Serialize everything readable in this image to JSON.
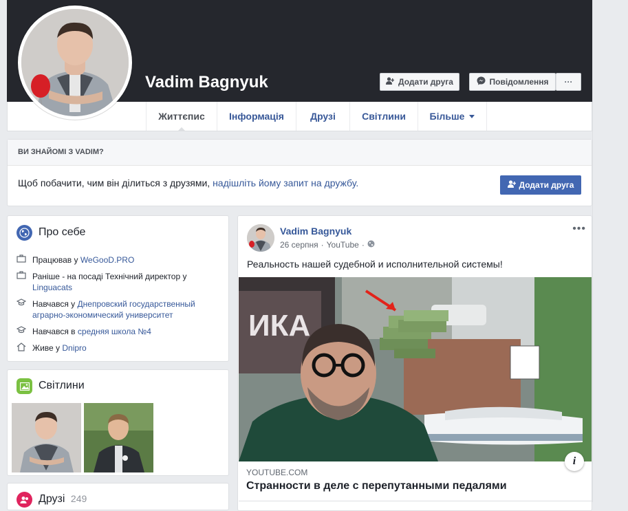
{
  "profile": {
    "name": "Vadim Bagnyuk",
    "add_friend_label": "Додати друга",
    "message_label": "Повідомлення",
    "more_label": "···"
  },
  "nav": {
    "tabs": [
      {
        "label": "Життєпис",
        "active": true
      },
      {
        "label": "Інформація"
      },
      {
        "label": "Друзі"
      },
      {
        "label": "Світлини"
      },
      {
        "label": "Більше"
      }
    ]
  },
  "know_box": {
    "heading": "ВИ ЗНАЙОМІ З VADIM?",
    "text": "Щоб побачити, чим він ділиться з друзями, ",
    "link": "надішліть йому запит на дружбу.",
    "button": "Додати друга"
  },
  "about": {
    "title": "Про себе",
    "items": [
      {
        "icon": "briefcase-icon",
        "prefix": "Працював у ",
        "link": "WeGooD.PRO"
      },
      {
        "icon": "briefcase-icon",
        "prefix": "Раніше - на посаді Технічний директор у ",
        "link": "Linguacats"
      },
      {
        "icon": "graduation-cap-icon",
        "prefix": "Навчався у ",
        "link": "Днепровский государственный аграрно-экономический университет"
      },
      {
        "icon": "graduation-cap-icon",
        "prefix": "Навчався в ",
        "link": "средняя школа №4"
      },
      {
        "icon": "home-icon",
        "prefix": "Живе у ",
        "link": "Dnipro"
      }
    ]
  },
  "photos": {
    "title": "Світлини"
  },
  "friends": {
    "title": "Друзі",
    "count": "249"
  },
  "post": {
    "author": "Vadim Bagnyuk",
    "date": "26 серпня",
    "separator": "·",
    "source": "YouTube",
    "text": "Реальность нашей судебной и исполнительной системы!",
    "sign_text": "ИКА",
    "link_domain": "YOUTUBE.COM",
    "link_title": "Странности в деле с перепутанными педалями",
    "info_label": "i"
  },
  "colors": {
    "cover": "#25272d",
    "link": "#365899",
    "primary_button": "#4267b2",
    "page_bg": "#e9ebee"
  }
}
